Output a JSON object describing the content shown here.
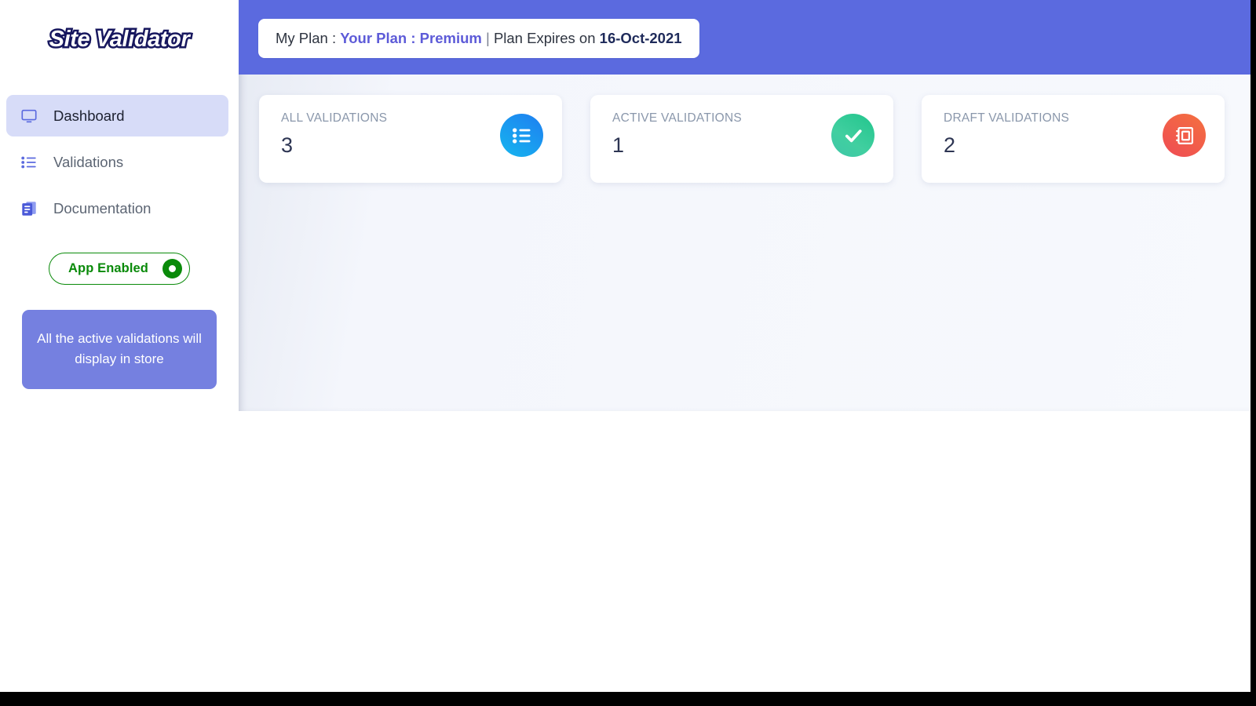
{
  "app": {
    "logo_text": "Site Validator"
  },
  "sidebar": {
    "items": [
      {
        "label": "Dashboard",
        "icon": "monitor-icon",
        "active": true
      },
      {
        "label": "Validations",
        "icon": "list-icon",
        "active": false
      },
      {
        "label": "Documentation",
        "icon": "document-icon",
        "active": false
      }
    ],
    "app_toggle": {
      "label": "App Enabled",
      "state": "enabled",
      "color": "#0a8a0a"
    },
    "info_card": {
      "text": "All the active validations will display in store",
      "background": "#7580e0"
    }
  },
  "header": {
    "background": "#5b6adf",
    "plan_banner": {
      "prefix": "My Plan : ",
      "plan": "Your Plan : Premium",
      "separator": " | ",
      "expiry_prefix": "Plan Expires on ",
      "expiry_date": "16-Oct-2021",
      "plan_color": "#5d5bd8",
      "date_color": "#1e2a5a"
    }
  },
  "main": {
    "stat_cards": [
      {
        "label": "ALL VALIDATIONS",
        "value": "3",
        "icon": "list-badge-icon",
        "accent": "#16b6ef"
      },
      {
        "label": "ACTIVE VALIDATIONS",
        "value": "1",
        "icon": "check-badge-icon",
        "accent": "#22c58c"
      },
      {
        "label": "DRAFT VALIDATIONS",
        "value": "2",
        "icon": "notebook-badge-icon",
        "accent": "#ef4b54"
      }
    ]
  }
}
